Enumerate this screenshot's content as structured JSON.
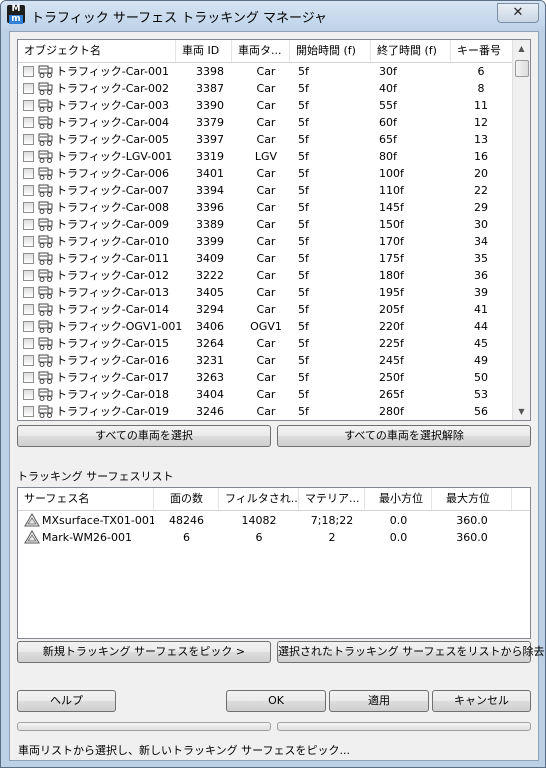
{
  "window": {
    "title": "トラフィック サーフェス トラッキング マネージャ",
    "app_icon_text": "M",
    "close_glyph": "✕"
  },
  "vehicle_list": {
    "columns": [
      "オブジェクト名",
      "車両 ID",
      "車両タ...",
      "開始時間 (f)",
      "終了時間 (f)",
      "キー番号"
    ],
    "rows": [
      {
        "name": "トラフィック-Car-001",
        "id": "3398",
        "type": "Car",
        "start": "5f",
        "end": "30f",
        "key": "6"
      },
      {
        "name": "トラフィック-Car-002",
        "id": "3387",
        "type": "Car",
        "start": "5f",
        "end": "40f",
        "key": "8"
      },
      {
        "name": "トラフィック-Car-003",
        "id": "3390",
        "type": "Car",
        "start": "5f",
        "end": "55f",
        "key": "11"
      },
      {
        "name": "トラフィック-Car-004",
        "id": "3379",
        "type": "Car",
        "start": "5f",
        "end": "60f",
        "key": "12"
      },
      {
        "name": "トラフィック-Car-005",
        "id": "3397",
        "type": "Car",
        "start": "5f",
        "end": "65f",
        "key": "13"
      },
      {
        "name": "トラフィック-LGV-001",
        "id": "3319",
        "type": "LGV",
        "start": "5f",
        "end": "80f",
        "key": "16"
      },
      {
        "name": "トラフィック-Car-006",
        "id": "3401",
        "type": "Car",
        "start": "5f",
        "end": "100f",
        "key": "20"
      },
      {
        "name": "トラフィック-Car-007",
        "id": "3394",
        "type": "Car",
        "start": "5f",
        "end": "110f",
        "key": "22"
      },
      {
        "name": "トラフィック-Car-008",
        "id": "3396",
        "type": "Car",
        "start": "5f",
        "end": "145f",
        "key": "29"
      },
      {
        "name": "トラフィック-Car-009",
        "id": "3389",
        "type": "Car",
        "start": "5f",
        "end": "150f",
        "key": "30"
      },
      {
        "name": "トラフィック-Car-010",
        "id": "3399",
        "type": "Car",
        "start": "5f",
        "end": "170f",
        "key": "34"
      },
      {
        "name": "トラフィック-Car-011",
        "id": "3409",
        "type": "Car",
        "start": "5f",
        "end": "175f",
        "key": "35"
      },
      {
        "name": "トラフィック-Car-012",
        "id": "3222",
        "type": "Car",
        "start": "5f",
        "end": "180f",
        "key": "36"
      },
      {
        "name": "トラフィック-Car-013",
        "id": "3405",
        "type": "Car",
        "start": "5f",
        "end": "195f",
        "key": "39"
      },
      {
        "name": "トラフィック-Car-014",
        "id": "3294",
        "type": "Car",
        "start": "5f",
        "end": "205f",
        "key": "41"
      },
      {
        "name": "トラフィック-OGV1-001",
        "id": "3406",
        "type": "OGV1",
        "start": "5f",
        "end": "220f",
        "key": "44"
      },
      {
        "name": "トラフィック-Car-015",
        "id": "3264",
        "type": "Car",
        "start": "5f",
        "end": "225f",
        "key": "45"
      },
      {
        "name": "トラフィック-Car-016",
        "id": "3231",
        "type": "Car",
        "start": "5f",
        "end": "245f",
        "key": "49"
      },
      {
        "name": "トラフィック-Car-017",
        "id": "3263",
        "type": "Car",
        "start": "5f",
        "end": "250f",
        "key": "50"
      },
      {
        "name": "トラフィック-Car-018",
        "id": "3404",
        "type": "Car",
        "start": "5f",
        "end": "265f",
        "key": "53"
      },
      {
        "name": "トラフィック-Car-019",
        "id": "3246",
        "type": "Car",
        "start": "5f",
        "end": "280f",
        "key": "56"
      }
    ],
    "select_all_label": "すべての車両を選択",
    "deselect_all_label": "すべての車両を選択解除"
  },
  "surface_list": {
    "label": "トラッキング サーフェスリスト",
    "columns": [
      "サーフェス名",
      "面の数",
      "フィルタされ...",
      "マテリア...",
      "最小方位",
      "最大方位"
    ],
    "rows": [
      {
        "name": "MXsurface-TX01-001",
        "faces": "48246",
        "filtered": "14082",
        "material": "7;18;22",
        "min": "0.0",
        "max": "360.0"
      },
      {
        "name": "Mark-WM26-001",
        "faces": "6",
        "filtered": "6",
        "material": "2",
        "min": "0.0",
        "max": "360.0"
      }
    ],
    "pick_label": "新規トラッキング サーフェスをピック >",
    "remove_label": "選択されたトラッキング サーフェスをリストから除去"
  },
  "footer": {
    "help_label": "ヘルプ",
    "ok_label": "OK",
    "apply_label": "適用",
    "cancel_label": "キャンセル",
    "status_text": "車両リストから選択し、新しいトラッキング サーフェスをピック..."
  },
  "icons": {
    "scroll_up": "scroll-up-arrow-icon",
    "scroll_down": "scroll-down-arrow-icon",
    "vehicle": "car-icon",
    "surface": "surface-icon"
  }
}
